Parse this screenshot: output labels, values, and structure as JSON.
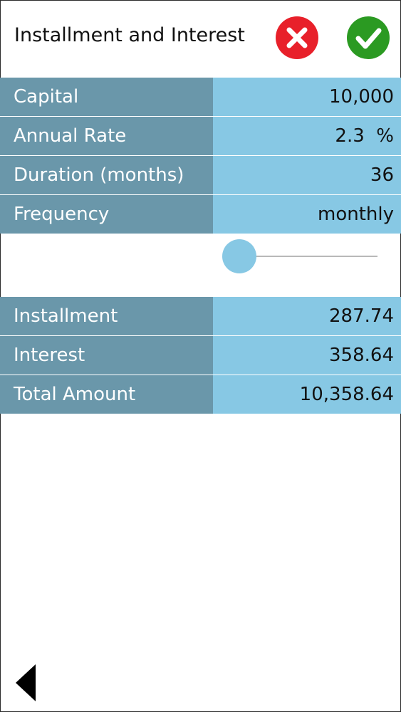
{
  "header": {
    "title": "Installment and Interest",
    "cancel_icon": "close-icon",
    "confirm_icon": "check-icon"
  },
  "inputs": [
    {
      "label": "Capital",
      "value": "10,000"
    },
    {
      "label": "Annual Rate",
      "value": "2.3  %"
    },
    {
      "label": "Duration (months)",
      "value": "36"
    },
    {
      "label": "Frequency",
      "value": "monthly"
    }
  ],
  "slider": {
    "position": 0
  },
  "results": [
    {
      "label": "Installment",
      "value": "287.74"
    },
    {
      "label": "Interest",
      "value": "358.64"
    },
    {
      "label": "Total Amount",
      "value": "10,358.64"
    }
  ],
  "footer": {
    "back_icon": "back-arrow-icon"
  },
  "colors": {
    "label_bg": "#6a97aa",
    "value_bg": "#87c8e4",
    "cancel_red": "#e8202a",
    "confirm_green": "#2b9a22"
  }
}
